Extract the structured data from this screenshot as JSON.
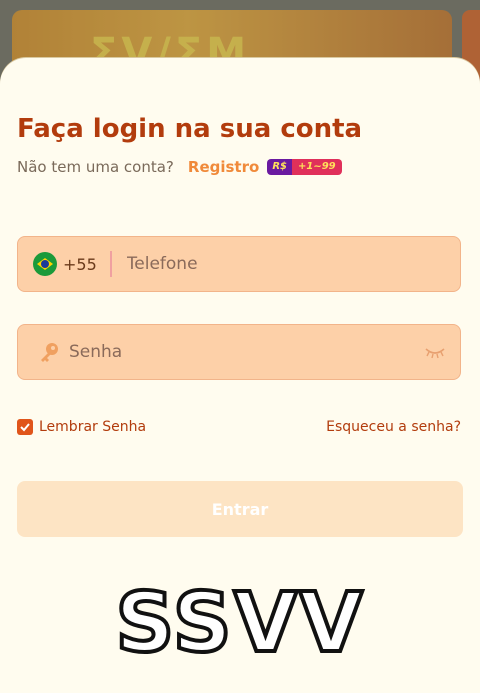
{
  "backdrop": {
    "banner_text": "ΣV/ΣM"
  },
  "login": {
    "title": "Faça login na sua conta",
    "no_account": "Não tem uma conta?",
    "register_link": "Registro",
    "bonus": {
      "currency": "R$",
      "amount": "+1~99"
    }
  },
  "phone": {
    "flag": "brazil-flag-icon",
    "country_code": "+55",
    "placeholder": "Telefone"
  },
  "password": {
    "icon": "key-icon",
    "placeholder": "Senha",
    "toggle_icon": "eye-closed-icon"
  },
  "options": {
    "remember_label": "Lembrar Senha",
    "remember_checked": true,
    "forgot_link": "Esqueceu a senha?"
  },
  "submit_label": "Entrar",
  "watermark": "SSVV",
  "colors": {
    "accent": "#b23c0d",
    "link": "#f08a3a",
    "field_bg": "#fdd0a8",
    "button_bg": "#fde4c4",
    "sheet_bg": "#fffcef"
  }
}
